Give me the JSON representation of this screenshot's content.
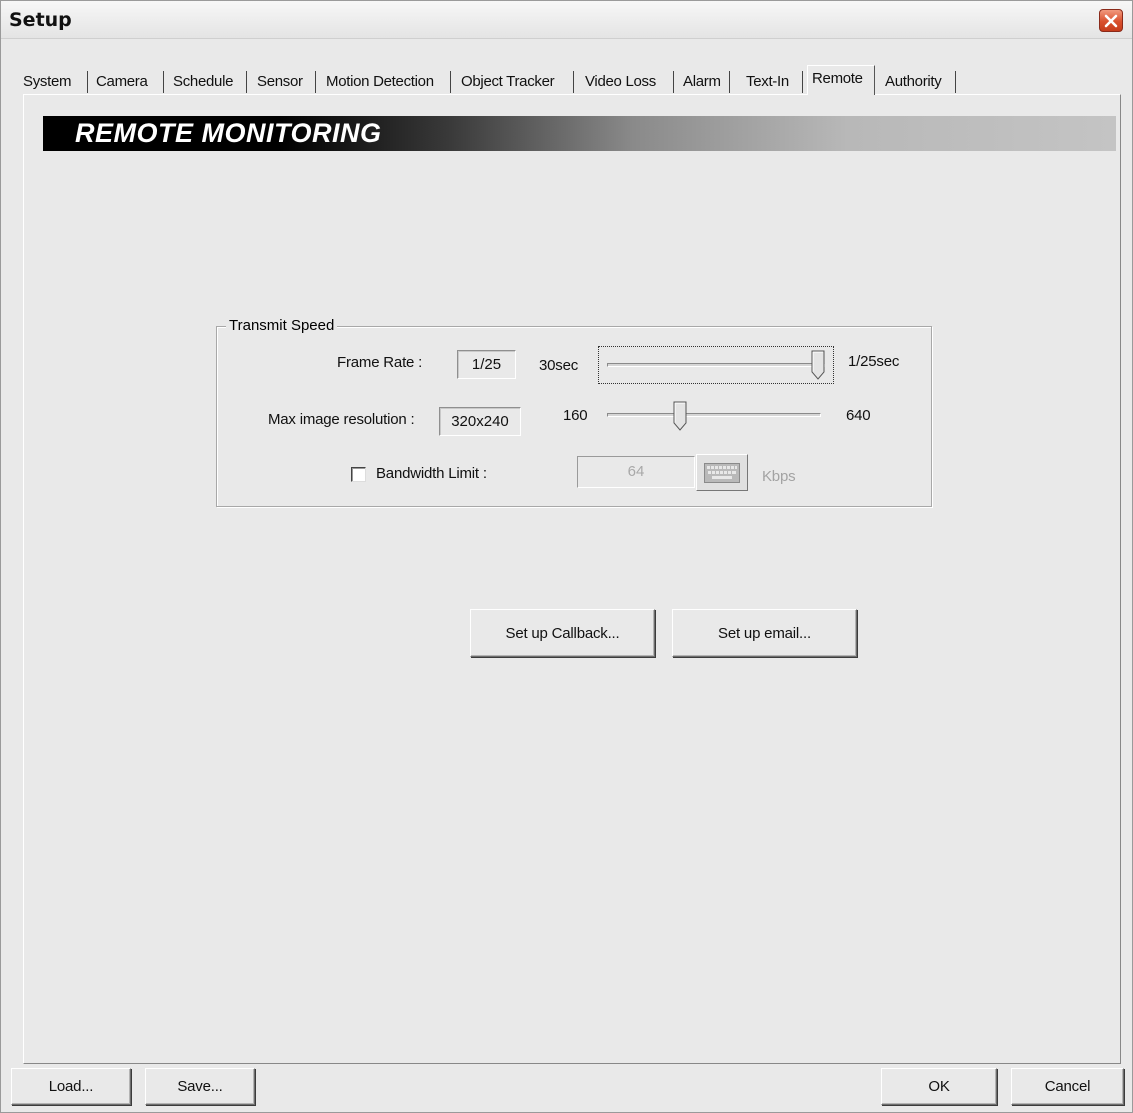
{
  "window": {
    "title": "Setup"
  },
  "tabs": [
    {
      "label": "System"
    },
    {
      "label": "Camera"
    },
    {
      "label": "Schedule"
    },
    {
      "label": "Sensor"
    },
    {
      "label": "Motion Detection"
    },
    {
      "label": "Object Tracker"
    },
    {
      "label": "Video Loss"
    },
    {
      "label": "Alarm"
    },
    {
      "label": "Text-In"
    },
    {
      "label": "Remote",
      "active": true
    },
    {
      "label": "Authority"
    }
  ],
  "banner": {
    "title": "REMOTE MONITORING"
  },
  "transmit_speed": {
    "group_label": "Transmit Speed",
    "frame_rate": {
      "label": "Frame Rate :",
      "value": "1/25",
      "min_label": "30sec",
      "max_label": "1/25sec",
      "slider_position": 1.0
    },
    "resolution": {
      "label": "Max image resolution :",
      "value": "320x240",
      "min_label": "160",
      "max_label": "640",
      "slider_position": 0.33
    },
    "bandwidth": {
      "label": "Bandwidth Limit :",
      "checked": false,
      "value": "64",
      "unit": "Kbps"
    }
  },
  "actions": {
    "callback_button": "Set up Callback...",
    "email_button": "Set up email..."
  },
  "footer": {
    "load_button": "Load...",
    "save_button": "Save...",
    "ok_button": "OK",
    "cancel_button": "Cancel"
  },
  "colors": {
    "close_button": "#d9502e",
    "dialog_bg": "#e9e9e9"
  }
}
